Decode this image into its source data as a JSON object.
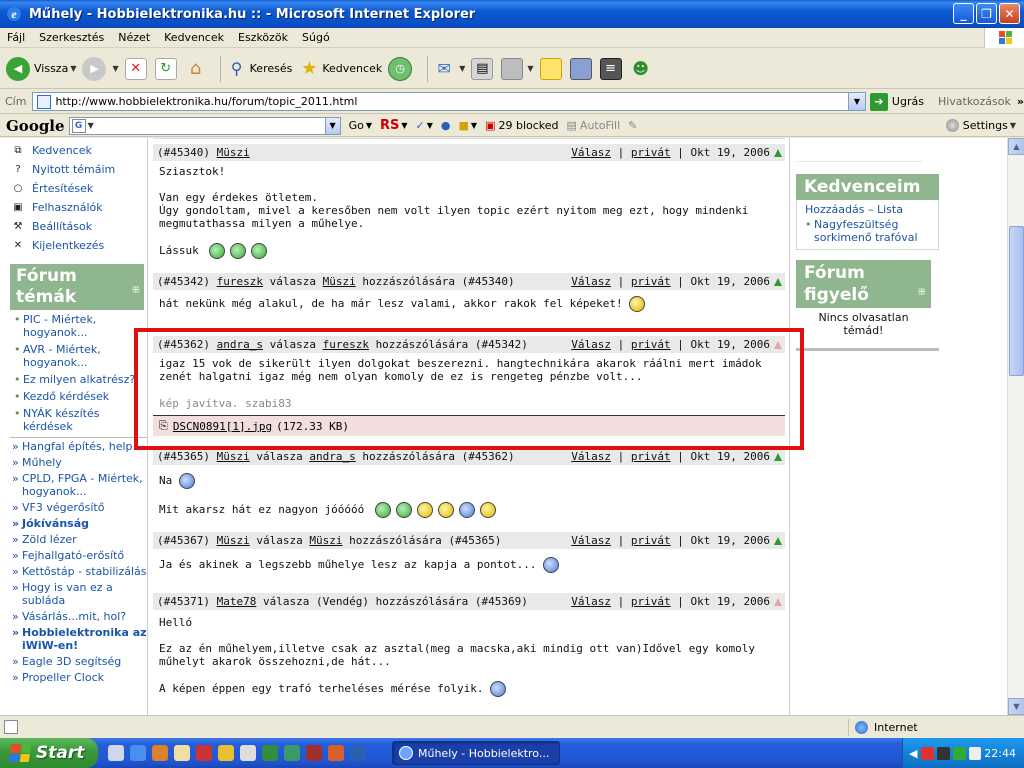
{
  "window": {
    "title": "Műhely - Hobbielektronika.hu :: - Microsoft Internet Explorer",
    "buttons": {
      "minimize": "_",
      "maximize": "❐",
      "close": "✕"
    }
  },
  "menu": [
    "Fájl",
    "Szerkesztés",
    "Nézet",
    "Kedvencek",
    "Eszközök",
    "Súgó"
  ],
  "toolbar": {
    "back": "Vissza",
    "search": "Keresés",
    "favorites": "Kedvencek"
  },
  "address": {
    "label": "Cím",
    "url": "http://www.hobbielektronika.hu/forum/topic_2011.html",
    "go": "Ugrás",
    "links": "Hivatkozások"
  },
  "google": {
    "logo": "Google",
    "go": "Go",
    "blocked": "29 blocked",
    "autofill": "AutoFill",
    "settings": "Settings"
  },
  "sidebar": {
    "user_menu": [
      {
        "label": "Kedvencek",
        "icon": "bookmark-icon"
      },
      {
        "label": "Nyitott témáim",
        "icon": "question-icon"
      },
      {
        "label": "Értesítések",
        "icon": "magnifier-icon"
      },
      {
        "label": "Felhasználók",
        "icon": "users-icon"
      },
      {
        "label": "Beállítások",
        "icon": "tools-icon"
      },
      {
        "label": "Kijelentkezés",
        "icon": "logout-icon"
      }
    ],
    "topics_title": "Fórum témák",
    "topics": [
      "PIC - Miértek, hogyanok...",
      "AVR - Miértek, hogyanok...",
      "Ez milyen alkatrész?",
      "Kezdő kérdések",
      "NYÁK készítés kérdések"
    ],
    "forums": [
      {
        "label": "Hangfal építés, help",
        "bold": false
      },
      {
        "label": "Műhely",
        "bold": false
      },
      {
        "label": "CPLD, FPGA - Miértek, hogyanok...",
        "bold": false
      },
      {
        "label": "VF3 végerősítő",
        "bold": false
      },
      {
        "label": "Jókívánság",
        "bold": true
      },
      {
        "label": "Zöld lézer",
        "bold": false
      },
      {
        "label": "Fejhallgató-erősítő",
        "bold": false
      },
      {
        "label": "Kettőstáp - stabilizálás",
        "bold": false
      },
      {
        "label": "Hogy is van ez a subláda",
        "bold": false
      },
      {
        "label": "Vásárlás...mit, hol?",
        "bold": false
      },
      {
        "label": "Hobbielektronika az iWiW-en!",
        "bold": true
      },
      {
        "label": "Eagle 3D segítség",
        "bold": false
      },
      {
        "label": "Propeller Clock",
        "bold": false
      }
    ]
  },
  "posts": [
    {
      "id": "(#45340)",
      "author": "Müszi",
      "reply_to": "",
      "reply_text": "",
      "reply_to_id": "",
      "reply": "Válasz",
      "private": "privát",
      "date": "Okt 19, 2006",
      "lines": [
        "Sziasztok!",
        "",
        "Van egy érdekes ötletem.",
        "Úgy gondoltam, mivel a keresőben nem volt ilyen topic ezért nyitom meg ezt, hogy mindenki megmutathassa milyen a műhelye.",
        "",
        "Lássuk"
      ]
    },
    {
      "id": "(#45342)",
      "author": "fureszk",
      "reply_text": "válasza",
      "reply_to": "Müszi",
      "reply_suffix": "hozzászólására",
      "reply_to_id": "(#45340)",
      "reply": "Válasz",
      "private": "privát",
      "date": "Okt 19, 2006",
      "lines": [
        "hát nekünk még alakul, de ha már lesz valami, akkor rakok fel képeket!"
      ]
    },
    {
      "id": "(#45362)",
      "author": "andra_s",
      "reply_text": "válasza",
      "reply_to": "fureszk",
      "reply_suffix": "hozzászólására",
      "reply_to_id": "(#45342)",
      "reply": "Válasz",
      "private": "privát",
      "date": "Okt 19, 2006",
      "lines": [
        "igaz 15 vok de sikerült ilyen dolgokat beszerezni. hangtechnikára akarok ráálni mert imádok zenét halgatni igaz még nem olyan komoly de ez is rengeteg pénzbe volt..."
      ],
      "edited": "kép javítva. szabi83",
      "attachment": {
        "name": "DSCN0891[1].jpg",
        "size": "(172.33 KB)"
      }
    },
    {
      "id": "(#45365)",
      "author": "Müszi",
      "reply_text": "válasza",
      "reply_to": "andra_s",
      "reply_suffix": "hozzászólására",
      "reply_to_id": "(#45362)",
      "reply": "Válasz",
      "private": "privát",
      "date": "Okt 19, 2006",
      "lines": [
        "Na",
        "",
        "Mit akarsz hát ez nagyon jóóóóó"
      ]
    },
    {
      "id": "(#45367)",
      "author": "Müszi",
      "reply_text": "válasza",
      "reply_to": "Müszi",
      "reply_suffix": "hozzászólására",
      "reply_to_id": "(#45365)",
      "reply": "Válasz",
      "private": "privát",
      "date": "Okt 19, 2006",
      "lines": [
        "Ja és akinek a legszebb műhelye lesz az kapja a pontot..."
      ]
    },
    {
      "id": "(#45371)",
      "author": "Mate78",
      "reply_text": "válasza",
      "reply_to": "(Vendég)",
      "reply_suffix": "hozzászólására",
      "reply_to_id": "(#45369)",
      "reply": "Válasz",
      "private": "privát",
      "date": "Okt 19, 2006",
      "lines": [
        "Helló",
        "",
        "Ez az én műhelyem,illetve csak az asztal(meg a macska,aki mindig ott van)Idővel egy komoly műhelyt akarok összehozni,de hát...",
        "",
        "A képen éppen egy trafó terheléses mérése folyik."
      ]
    }
  ],
  "right": {
    "fav_title": "Kedvenceim",
    "fav_add": "Hozzáadás",
    "fav_dash": "–",
    "fav_list": "Lista",
    "fav_item": "Nagyfeszültség sorkimenő trafóval",
    "watch_title": "Fórum figyelő",
    "watch_empty": "Nincs olvasatlan témád!"
  },
  "status": {
    "zone": "Internet"
  },
  "taskbar": {
    "start": "Start",
    "task": "Műhely - Hobbielektro...",
    "clock": "22:44"
  }
}
